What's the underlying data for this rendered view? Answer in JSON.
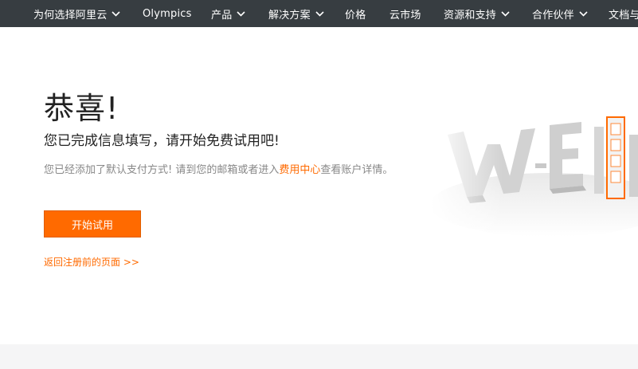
{
  "nav": {
    "items": [
      {
        "label": "为何选择阿里云",
        "dropdown": true
      },
      {
        "label": "Olympics",
        "dropdown": false
      },
      {
        "label": "产品",
        "dropdown": true
      },
      {
        "label": "解决方案",
        "dropdown": true
      },
      {
        "label": "价格",
        "dropdown": false
      },
      {
        "label": "云市场",
        "dropdown": false
      },
      {
        "label": "资源和支持",
        "dropdown": true
      },
      {
        "label": "合作伙伴",
        "dropdown": true
      },
      {
        "label": "文档与",
        "dropdown": false
      }
    ]
  },
  "main": {
    "title": "恭喜!",
    "subtitle": "您已完成信息填写，请开始免费试用吧!",
    "desc_before": "您已经添加了默认支付方式! 请到您的邮箱或者进入",
    "desc_link": "费用中心",
    "desc_after": "查看账户详情。",
    "start_button": "开始试用",
    "back_link": "返回注册前的页面 >>"
  },
  "hero": {
    "letters": [
      "W",
      "E",
      "L"
    ]
  },
  "colors": {
    "nav_bg": "#373d41",
    "accent": "#ff6a00",
    "footer_bg": "#f5f5f6"
  }
}
